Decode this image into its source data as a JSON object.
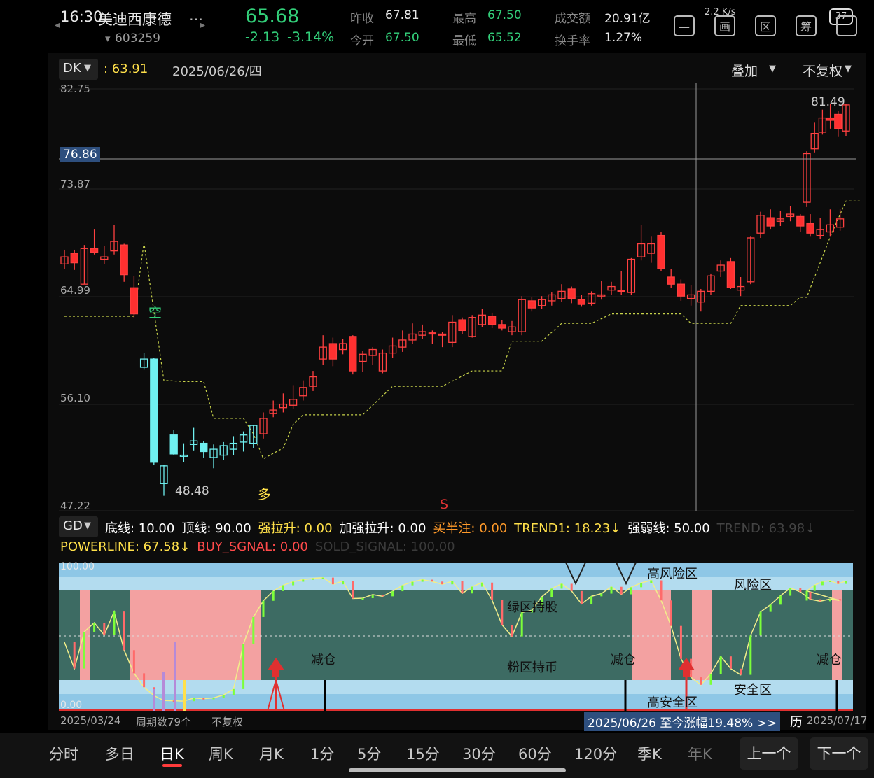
{
  "status": {
    "time": "16:30",
    "battery": "37",
    "net_speed": "2.2 K/s"
  },
  "stock": {
    "name": "美迪西康德",
    "code": "603259",
    "price": "65.68",
    "change": "-2.13",
    "change_pct": "-3.14%",
    "prev_close_label": "昨收",
    "prev_close": "67.81",
    "open_label": "今开",
    "open": "67.50",
    "high_label": "最高",
    "high": "67.50",
    "low_label": "最低",
    "low": "65.52",
    "volume_label": "成交额",
    "volume": "20.91亿",
    "turnover_label": "换手率",
    "turnover": "1.27%"
  },
  "toolbar_icons": [
    "minus-icon",
    "picture-icon",
    "area-icon",
    "chip-icon",
    "window-icon"
  ],
  "toolbar_glyphs": [
    "—",
    "画",
    "区",
    "筹",
    ""
  ],
  "chart_header": {
    "indicator": "DK",
    "indicator_value": ": 63.91",
    "date": "2025/06/26/四",
    "overlay": "叠加",
    "adjust": "不复权"
  },
  "price_axis": {
    "ticks": [
      "82.75",
      "73.87",
      "64.99",
      "56.10",
      "47.22"
    ],
    "crosshair_value": "76.86"
  },
  "annotations": {
    "high_label": "81.49",
    "low_label": "48.48",
    "short": "空",
    "long": "多",
    "sell": "S"
  },
  "sub_indicator": {
    "name": "GD",
    "line1": [
      {
        "text": "底线: 10.00",
        "color": "#ffffff"
      },
      {
        "text": "顶线: 90.00",
        "color": "#ffffff"
      },
      {
        "text": "强拉升: 0.00",
        "color": "#ffe04a"
      },
      {
        "text": "加强拉升: 0.00",
        "color": "#ffffff"
      },
      {
        "text": "买半注: 0.00",
        "color": "#ff9a2a"
      },
      {
        "text": "TREND1: 18.23↓",
        "color": "#ffe04a"
      },
      {
        "text": "强弱线: 50.00",
        "color": "#ffffff"
      },
      {
        "text": "TREND: 63.98↓",
        "color": "#444444"
      }
    ],
    "line2": [
      {
        "text": "POWERLINE: 67.58↓",
        "color": "#ffe04a"
      },
      {
        "text": "BUY_SGNAL: 0.00",
        "color": "#ff4a4a"
      },
      {
        "text": "SOLD_SIGNAL: 100.00",
        "color": "#3a3a3a"
      }
    ],
    "axis_top": "100.00",
    "axis_bottom": "0.00",
    "zones": {
      "high_risk": "高风险区",
      "risk": "风险区",
      "green_hold": "绿区持股",
      "pink_hold": "粉区持币",
      "reduce": "减仓",
      "safe": "安全区",
      "high_safe": "高安全区"
    }
  },
  "date_axis": {
    "start": "2025/03/24",
    "periods": "周期数79个",
    "adjust": "不复权",
    "end": "2025/07/17",
    "banner": "2025/06/26 至今涨幅19.48% >>",
    "banner_tail": "历"
  },
  "periods": [
    "分时",
    "多日",
    "日K",
    "周K",
    "月K",
    "1分",
    "5分",
    "15分",
    "30分",
    "60分",
    "120分",
    "季K",
    "年K"
  ],
  "active_period": "日K",
  "nav": {
    "prev": "上一个",
    "next": "下一个"
  },
  "chart_data": {
    "type": "candlestick",
    "y_range": [
      47.22,
      82.75
    ],
    "candles": [
      {
        "o": 68.0,
        "c": 68.6,
        "h": 69.2,
        "l": 67.6
      },
      {
        "o": 68.9,
        "c": 68.1,
        "h": 69.2,
        "l": 67.5
      },
      {
        "o": 66.3,
        "c": 69.3,
        "h": 69.6,
        "l": 66.3
      },
      {
        "o": 69.3,
        "c": 69.0,
        "h": 70.9,
        "l": 68.8
      },
      {
        "o": 68.4,
        "c": 68.6,
        "h": 69.5,
        "l": 68.0
      },
      {
        "o": 69.1,
        "c": 69.9,
        "h": 71.3,
        "l": 68.8
      },
      {
        "o": 69.6,
        "c": 67.1,
        "h": 69.7,
        "l": 66.5
      },
      {
        "o": 66.0,
        "c": 63.8,
        "h": 67.0,
        "l": 63.5
      },
      {
        "o": 59.3,
        "c": 60.0,
        "h": 60.5,
        "l": 59.1
      },
      {
        "o": 60.0,
        "c": 51.3,
        "h": 60.1,
        "l": 51.1
      },
      {
        "o": 49.5,
        "c": 51.0,
        "h": 51.1,
        "l": 48.48
      },
      {
        "o": 53.6,
        "c": 52.0,
        "h": 54.0,
        "l": 51.9
      },
      {
        "o": 51.8,
        "c": 51.9,
        "h": 52.9,
        "l": 51.3
      },
      {
        "o": 52.8,
        "c": 53.1,
        "h": 54.2,
        "l": 52.3
      },
      {
        "o": 52.9,
        "c": 52.2,
        "h": 53.1,
        "l": 51.7
      },
      {
        "o": 51.7,
        "c": 52.4,
        "h": 52.8,
        "l": 50.8
      },
      {
        "o": 51.9,
        "c": 52.7,
        "h": 53.0,
        "l": 51.5
      },
      {
        "o": 52.4,
        "c": 52.9,
        "h": 53.5,
        "l": 51.9
      },
      {
        "o": 53.0,
        "c": 53.6,
        "h": 53.9,
        "l": 52.2
      },
      {
        "o": 52.9,
        "c": 54.4,
        "h": 54.4,
        "l": 52.5
      },
      {
        "o": 53.7,
        "c": 55.0,
        "h": 55.5,
        "l": 53.3
      },
      {
        "o": 55.4,
        "c": 55.7,
        "h": 56.5,
        "l": 55.1
      },
      {
        "o": 55.9,
        "c": 56.2,
        "h": 57.1,
        "l": 55.5
      },
      {
        "o": 56.1,
        "c": 56.6,
        "h": 57.8,
        "l": 55.8
      },
      {
        "o": 56.9,
        "c": 57.6,
        "h": 58.2,
        "l": 56.5
      },
      {
        "o": 57.7,
        "c": 58.5,
        "h": 59.0,
        "l": 57.3
      },
      {
        "o": 60.0,
        "c": 61.0,
        "h": 62.0,
        "l": 59.5
      },
      {
        "o": 61.3,
        "c": 60.0,
        "h": 61.8,
        "l": 59.4
      },
      {
        "o": 60.8,
        "c": 61.3,
        "h": 61.7,
        "l": 60.4
      },
      {
        "o": 61.9,
        "c": 59.0,
        "h": 62.0,
        "l": 58.7
      },
      {
        "o": 59.8,
        "c": 60.4,
        "h": 60.7,
        "l": 58.9
      },
      {
        "o": 60.3,
        "c": 60.8,
        "h": 61.0,
        "l": 59.5
      },
      {
        "o": 59.0,
        "c": 60.5,
        "h": 60.8,
        "l": 58.8
      },
      {
        "o": 60.5,
        "c": 61.1,
        "h": 61.8,
        "l": 60.1
      },
      {
        "o": 61.0,
        "c": 61.6,
        "h": 62.4,
        "l": 60.6
      },
      {
        "o": 61.6,
        "c": 62.1,
        "h": 63.0,
        "l": 61.3
      },
      {
        "o": 62.0,
        "c": 62.3,
        "h": 62.9,
        "l": 61.7
      },
      {
        "o": 62.2,
        "c": 62.1,
        "h": 62.4,
        "l": 61.3
      },
      {
        "o": 62.1,
        "c": 62.0,
        "h": 62.3,
        "l": 61.0
      },
      {
        "o": 61.4,
        "c": 63.1,
        "h": 63.7,
        "l": 61.0
      },
      {
        "o": 63.3,
        "c": 62.4,
        "h": 63.5,
        "l": 62.1
      },
      {
        "o": 61.9,
        "c": 63.5,
        "h": 63.7,
        "l": 61.8
      },
      {
        "o": 62.9,
        "c": 63.7,
        "h": 64.2,
        "l": 62.7
      },
      {
        "o": 63.6,
        "c": 62.9,
        "h": 63.9,
        "l": 62.6
      },
      {
        "o": 62.9,
        "c": 62.6,
        "h": 63.3,
        "l": 62.4
      },
      {
        "o": 62.3,
        "c": 62.7,
        "h": 63.2,
        "l": 62.0
      },
      {
        "o": 62.3,
        "c": 65.0,
        "h": 65.3,
        "l": 62.0
      },
      {
        "o": 64.9,
        "c": 64.3,
        "h": 65.2,
        "l": 64.0
      },
      {
        "o": 64.5,
        "c": 65.0,
        "h": 65.3,
        "l": 64.2
      },
      {
        "o": 64.9,
        "c": 65.4,
        "h": 65.6,
        "l": 64.5
      },
      {
        "o": 65.1,
        "c": 65.7,
        "h": 66.3,
        "l": 64.8
      },
      {
        "o": 65.9,
        "c": 65.1,
        "h": 66.1,
        "l": 64.7
      },
      {
        "o": 65.0,
        "c": 64.6,
        "h": 65.4,
        "l": 64.4
      },
      {
        "o": 64.7,
        "c": 65.5,
        "h": 65.7,
        "l": 64.5
      },
      {
        "o": 65.3,
        "c": 65.4,
        "h": 66.6,
        "l": 65.0
      },
      {
        "o": 65.8,
        "c": 66.1,
        "h": 66.5,
        "l": 65.4
      },
      {
        "o": 65.8,
        "c": 65.7,
        "h": 67.4,
        "l": 65.4
      },
      {
        "o": 65.6,
        "c": 68.4,
        "h": 68.5,
        "l": 65.4
      },
      {
        "o": 68.6,
        "c": 69.7,
        "h": 71.3,
        "l": 68.3
      },
      {
        "o": 68.9,
        "c": 69.7,
        "h": 70.3,
        "l": 68.1
      },
      {
        "o": 70.4,
        "c": 67.6,
        "h": 70.7,
        "l": 67.4
      },
      {
        "o": 66.9,
        "c": 66.3,
        "h": 67.6,
        "l": 66.0
      },
      {
        "o": 66.3,
        "c": 65.3,
        "h": 66.7,
        "l": 64.9
      },
      {
        "o": 65.1,
        "c": 65.4,
        "h": 66.2,
        "l": 64.5
      },
      {
        "o": 64.8,
        "c": 65.7,
        "h": 65.9,
        "l": 64.0
      },
      {
        "o": 65.7,
        "c": 67.0,
        "h": 67.2,
        "l": 65.4
      },
      {
        "o": 67.4,
        "c": 67.9,
        "h": 68.3,
        "l": 66.9
      },
      {
        "o": 68.2,
        "c": 66.0,
        "h": 68.5,
        "l": 65.9
      },
      {
        "o": 65.8,
        "c": 66.1,
        "h": 66.9,
        "l": 65.3
      },
      {
        "o": 66.5,
        "c": 70.2,
        "h": 70.3,
        "l": 66.3
      },
      {
        "o": 70.6,
        "c": 72.1,
        "h": 72.4,
        "l": 70.2
      },
      {
        "o": 71.9,
        "c": 71.2,
        "h": 72.6,
        "l": 70.9
      },
      {
        "o": 71.6,
        "c": 71.8,
        "h": 72.5,
        "l": 71.2
      },
      {
        "o": 72.0,
        "c": 72.2,
        "h": 72.9,
        "l": 71.6
      },
      {
        "o": 72.0,
        "c": 71.2,
        "h": 72.2,
        "l": 70.7
      },
      {
        "o": 71.4,
        "c": 70.6,
        "h": 72.2,
        "l": 70.3
      },
      {
        "o": 70.4,
        "c": 70.9,
        "h": 71.9,
        "l": 70.1
      },
      {
        "o": 70.7,
        "c": 71.3,
        "h": 72.6,
        "l": 70.3
      },
      {
        "o": 71.1,
        "c": 71.8,
        "h": 72.6,
        "l": 70.8
      }
    ],
    "tail_candles": [
      {
        "o": 73.2,
        "c": 77.3,
        "h": 77.5,
        "l": 72.8
      },
      {
        "o": 77.7,
        "c": 79.0,
        "h": 79.9,
        "l": 77.4
      },
      {
        "o": 79.1,
        "c": 80.3,
        "h": 81.0,
        "l": 78.9
      },
      {
        "o": 80.3,
        "c": 80.1,
        "h": 81.49,
        "l": 79.4
      },
      {
        "o": 80.6,
        "c": 79.4,
        "h": 80.9,
        "l": 78.7
      },
      {
        "o": 79.2,
        "c": 81.4,
        "h": 81.5,
        "l": 78.8
      }
    ],
    "dk_line": [
      [
        0,
        63.6
      ],
      [
        7,
        63.6
      ],
      [
        8,
        69.8
      ],
      [
        10,
        58.2
      ],
      [
        12,
        58.1
      ],
      [
        14,
        58.1
      ],
      [
        15,
        55.0
      ],
      [
        18,
        55.0
      ],
      [
        19,
        53.7
      ],
      [
        20,
        51.6
      ],
      [
        22,
        52.5
      ],
      [
        23,
        54.5
      ],
      [
        24,
        55.3
      ],
      [
        30,
        55.3
      ],
      [
        33,
        57.7
      ],
      [
        38,
        57.7
      ],
      [
        41,
        59.0
      ],
      [
        44,
        59.0
      ],
      [
        45,
        61.5
      ],
      [
        48,
        61.5
      ],
      [
        50,
        63.0
      ],
      [
        53,
        63.0
      ],
      [
        55,
        63.8
      ],
      [
        62,
        63.8
      ],
      [
        63,
        63.0
      ],
      [
        67,
        63.0
      ],
      [
        68,
        64.5
      ],
      [
        73,
        64.5
      ],
      [
        74,
        65.2
      ],
      [
        79,
        65.2
      ],
      [
        82,
        70.3
      ],
      [
        84,
        73.3
      ],
      [
        86,
        73.3
      ]
    ],
    "dk_x_offset": [
      0,
      0
    ],
    "crosshair_index": 65
  }
}
